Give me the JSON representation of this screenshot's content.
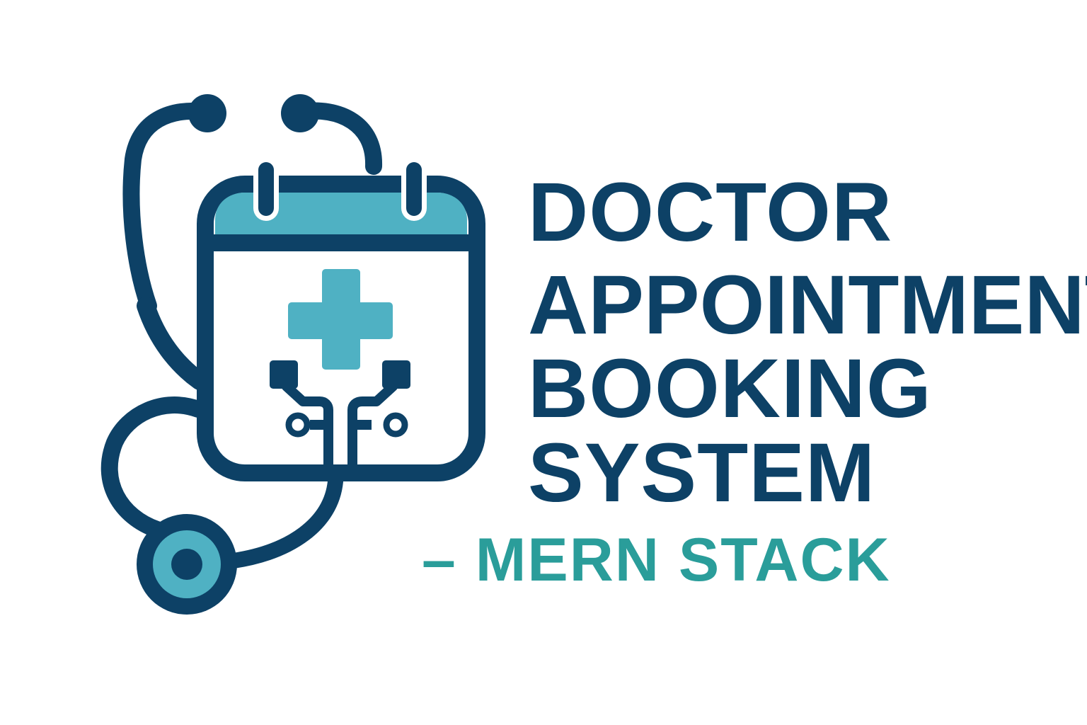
{
  "colors": {
    "navy": "#0d4166",
    "teal": "#4fb1c3",
    "subtitle": "#2a9d9a",
    "background": "#ffffff"
  },
  "logo": {
    "icons": [
      "stethoscope-icon",
      "calendar-icon",
      "medical-cross-icon",
      "circuit-icon"
    ]
  },
  "title": {
    "line1": "DOCTOR",
    "line2": "APPOINTMENT",
    "line3": "BOOKING",
    "line4": "SYSTEM"
  },
  "subtitle": "– MERN STACK"
}
